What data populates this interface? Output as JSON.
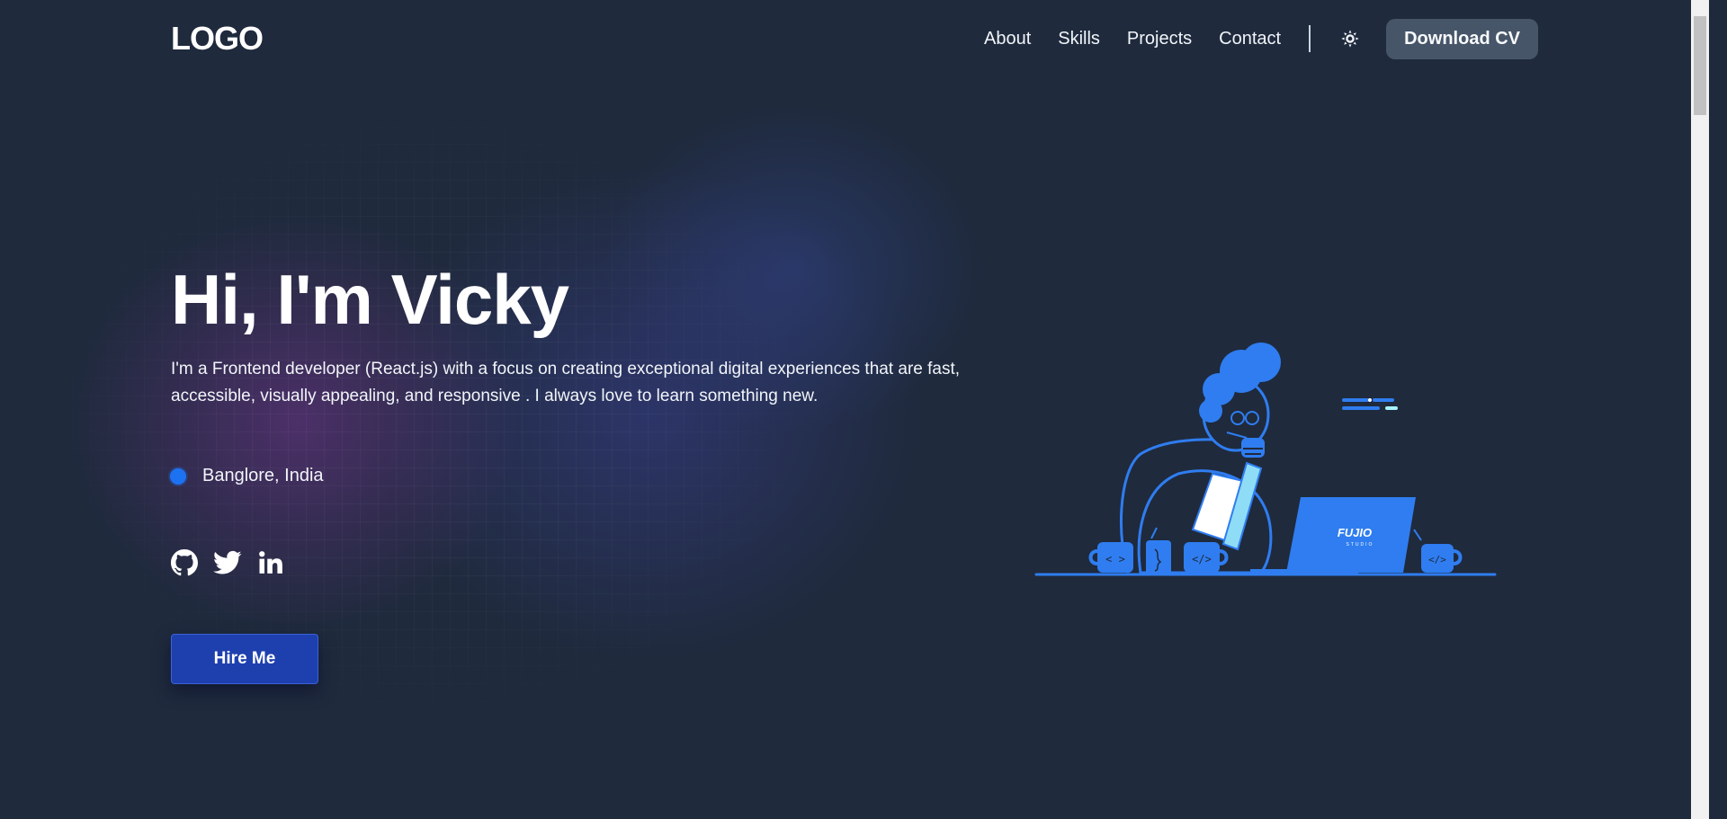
{
  "header": {
    "logo": "LOGO",
    "nav": {
      "about": "About",
      "skills": "Skills",
      "projects": "Projects",
      "contact": "Contact"
    },
    "theme_icon": "sun-icon",
    "download_cv": "Download CV"
  },
  "hero": {
    "title": "Hi, I'm Vicky",
    "description": "I'm a Frontend developer (React.js) with a focus on creating exceptional digital experiences that are fast, accessible, visually appealing, and responsive . I always love to learn something new.",
    "location": "Banglore, India",
    "socials": [
      "github-icon",
      "twitter-icon",
      "linkedin-icon"
    ],
    "hire_label": "Hire Me"
  },
  "illustration": {
    "laptop_brand": "FUJIO",
    "laptop_sub": "STUDIO",
    "mug_labels": [
      "< >",
      "</>",
      "</>"
    ]
  },
  "colors": {
    "background": "#1f2a3d",
    "accent": "#2f7df0",
    "button": "#1e40af",
    "cv_button": "#475569"
  }
}
